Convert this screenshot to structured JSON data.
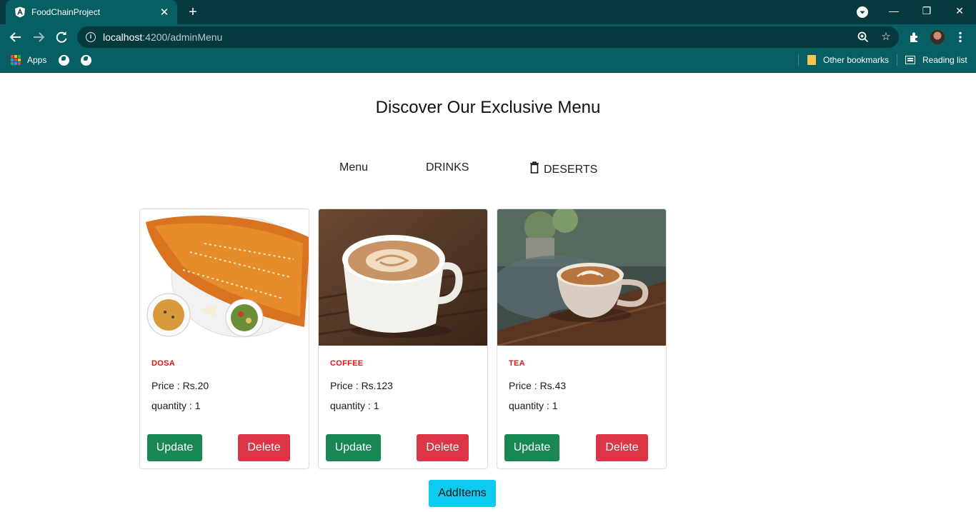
{
  "browser": {
    "tab_title": "FoodChainProject",
    "url_host": "localhost",
    "url_path": ":4200/adminMenu",
    "bookmarks": {
      "apps_label": "Apps",
      "other_label": "Other bookmarks",
      "reading_label": "Reading list"
    }
  },
  "page": {
    "heading": "Discover Our Exclusive Menu",
    "nav": [
      "Menu",
      "DRINKS",
      "DESERTS"
    ]
  },
  "cards": [
    {
      "name": "DOSA",
      "price": "Price : Rs.20",
      "quantity": "quantity : 1",
      "update_label": "Update",
      "delete_label": "Delete"
    },
    {
      "name": "COFFEE",
      "price": "Price : Rs.123",
      "quantity": "quantity : 1",
      "update_label": "Update",
      "delete_label": "Delete"
    },
    {
      "name": "TEA",
      "price": "Price : Rs.43",
      "quantity": "quantity : 1",
      "update_label": "Update",
      "delete_label": "Delete"
    }
  ],
  "add_button_label": "AddItems",
  "colors": {
    "chrome_dark": "#04393d",
    "chrome": "#075e63",
    "item_name": "#ee1111",
    "update": "#198754",
    "delete": "#dc3545",
    "add": "#0dcaf0"
  }
}
